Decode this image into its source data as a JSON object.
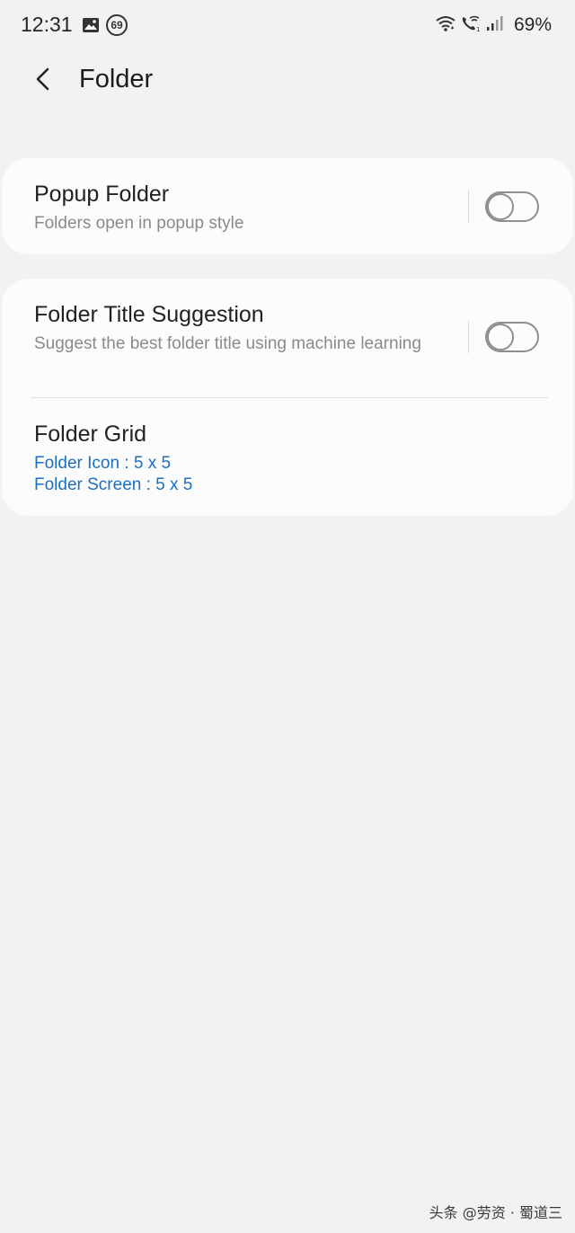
{
  "status_bar": {
    "time": "12:31",
    "notification_badge": "69",
    "battery": "69%",
    "icons": [
      "gallery-icon",
      "badge-icon",
      "wifi-icon",
      "wifi-call-icon",
      "signal-icon"
    ]
  },
  "header": {
    "back_icon": "chevron-left-icon",
    "title": "Folder"
  },
  "settings": {
    "popup_folder": {
      "title": "Popup Folder",
      "subtitle": "Folders open in popup style",
      "enabled": false
    },
    "title_suggestion": {
      "title": "Folder Title Suggestion",
      "subtitle": "Suggest the best folder title using machine learning",
      "enabled": false
    },
    "folder_grid": {
      "title": "Folder Grid",
      "icon_value": "Folder Icon : 5 x 5",
      "screen_value": "Folder Screen : 5 x 5"
    }
  },
  "colors": {
    "background": "#f2f2f2",
    "card": "#fcfcfc",
    "accent": "#1a6fbf",
    "secondary_text": "#8a8a8a"
  },
  "watermark": "头条 @劳资 · 蜀道三"
}
